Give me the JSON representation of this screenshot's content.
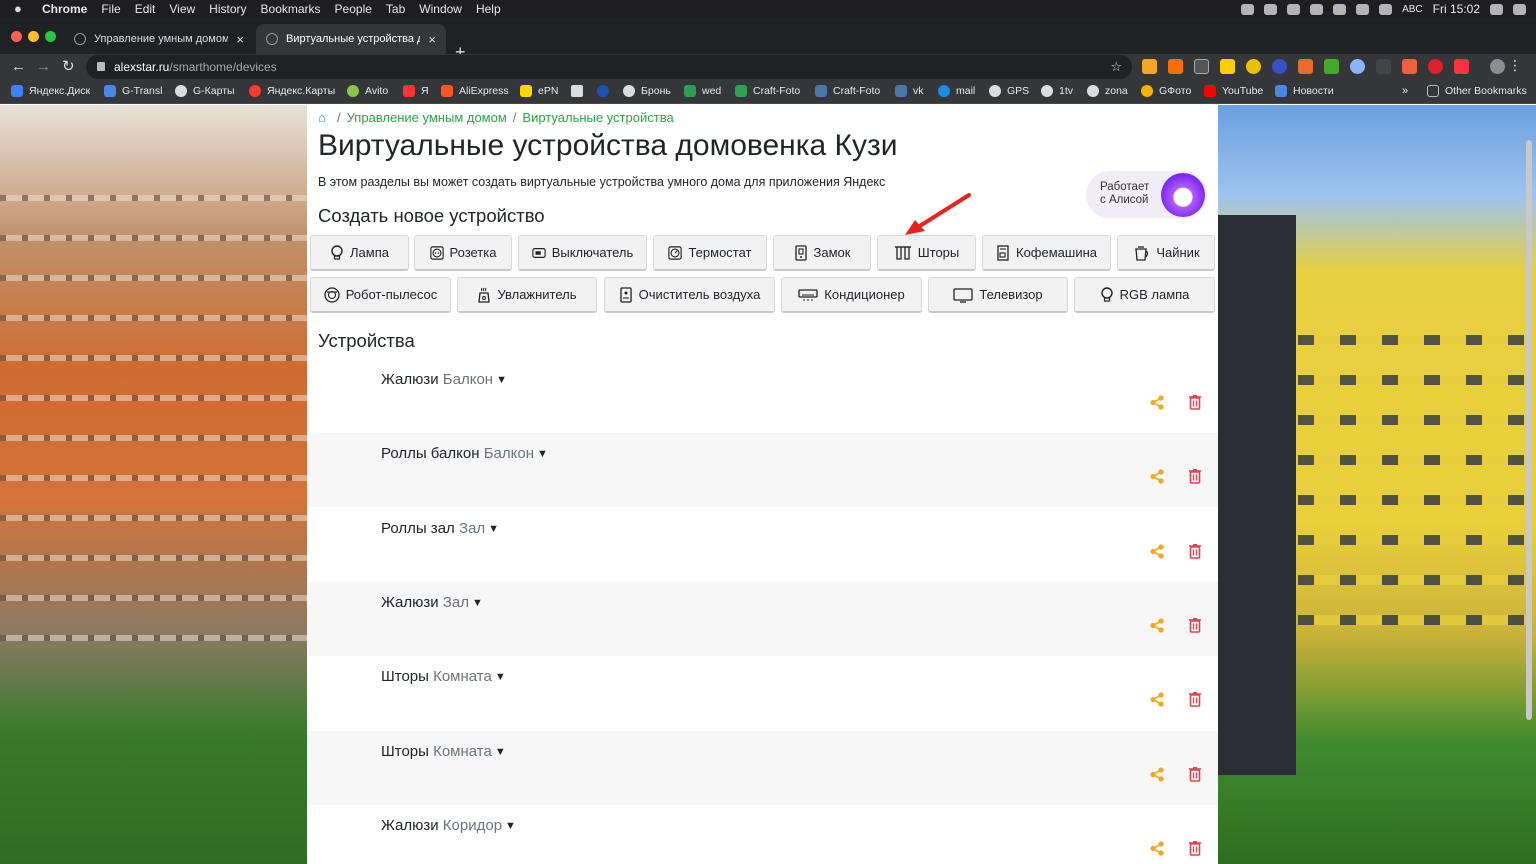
{
  "menubar": {
    "app": "Chrome",
    "items": [
      "File",
      "Edit",
      "View",
      "History",
      "Bookmarks",
      "People",
      "Tab",
      "Window",
      "Help"
    ],
    "input_source": "ABC",
    "clock": "Fri 15:02"
  },
  "tabs": [
    {
      "title": "Управление умным домом",
      "active": false
    },
    {
      "title": "Виртуальные устройства домовенка Кузи",
      "active": true
    }
  ],
  "omnibox": {
    "host": "alexstar.ru",
    "path": "/smarthome/devices"
  },
  "bookmarks": [
    {
      "label": "Яндекс.Диск",
      "color": "#3c82f7"
    },
    {
      "label": "G-Transl",
      "color": "#4a86e8"
    },
    {
      "label": "G-Карты",
      "color": "#dddddd"
    },
    {
      "label": "Яндекс.Карты",
      "color": "#ff3b30"
    },
    {
      "label": "Avito",
      "color": "#8bc34a"
    },
    {
      "label": "Я",
      "color": "#ff3333"
    },
    {
      "label": "AliExpress",
      "color": "#ff5722"
    },
    {
      "label": "ePN",
      "color": "#ffd600"
    },
    {
      "label": "Бронь",
      "color": "#dddddd"
    },
    {
      "label": "wed",
      "color": "#2e9f52"
    },
    {
      "label": "Craft-Foto",
      "color": "#2e9f52"
    },
    {
      "label": "Craft-Foto",
      "color": "#4a76a8"
    },
    {
      "label": "vk",
      "color": "#4a76a8"
    },
    {
      "label": "mail",
      "color": "#168de2"
    },
    {
      "label": "GPS",
      "color": "#dddddd"
    },
    {
      "label": "1tv",
      "color": "#dddddd"
    },
    {
      "label": "zona",
      "color": "#dddddd"
    },
    {
      "label": "GФото",
      "color": "#f4b400"
    },
    {
      "label": "YouTube",
      "color": "#ff0000"
    },
    {
      "label": "Новости",
      "color": "#4a86e8"
    }
  ],
  "other_bookmarks": "Other Bookmarks",
  "breadcrumb": {
    "home": "Управление умным домом",
    "current": "Виртуальные устройства"
  },
  "page": {
    "title": "Виртуальные устройства домовенка Кузи",
    "description": "В этом разделы вы может создать виртуальные устройства умного дома для приложения Яндекс",
    "alice_badge_line1": "Работает",
    "alice_badge_line2": "с Алисой",
    "create_heading": "Создать новое устройство",
    "devices_heading": "Устройства"
  },
  "device_types_row1": [
    "Лампа",
    "Розетка",
    "Выключатель",
    "Термостат",
    "Замок",
    "Шторы",
    "Кофемашина",
    "Чайник"
  ],
  "device_types_row2": [
    "Робот-пылесос",
    "Увлажнитель",
    "Очиститель воздуха",
    "Кондиционер",
    "Телевизор",
    "RGB лампа"
  ],
  "devices": [
    {
      "name": "Жалюзи",
      "room": "Балкон"
    },
    {
      "name": "Роллы балкон",
      "room": "Балкон"
    },
    {
      "name": "Роллы зал",
      "room": "Зал"
    },
    {
      "name": "Жалюзи",
      "room": "Зал"
    },
    {
      "name": "Шторы",
      "room": "Комната"
    },
    {
      "name": "Шторы",
      "room": "Комната"
    },
    {
      "name": "Жалюзи",
      "room": "Коридор"
    }
  ],
  "colors": {
    "link_green": "#28a745",
    "share_orange": "#f5a623",
    "delete_red": "#e0454f",
    "arrow_red": "#e8231c"
  }
}
